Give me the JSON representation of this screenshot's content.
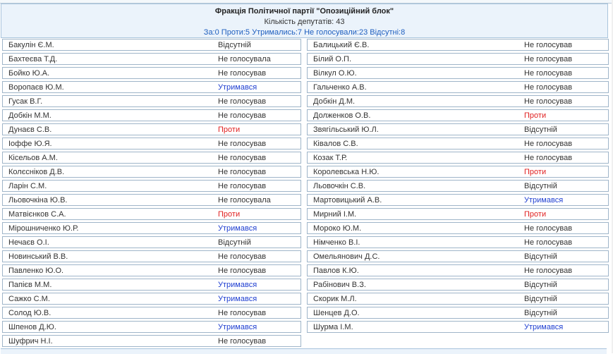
{
  "faction": {
    "title": "Фракція Політичної партії \"Опозиційний блок\"",
    "deputies_count": "Кількість депутатів: 43",
    "summary": "За:0 Проти:5 Утримались:7 Не голосували:23 Відсутні:8"
  },
  "colors": {
    "header_bg": "#ebf3fb",
    "border": "#9fb5c9",
    "summary_text": "#1f5fbf",
    "abstain": "#1f3fd1",
    "against": "#e02020"
  },
  "rows": [
    {
      "left": {
        "name": "Бакулін Є.М.",
        "vote": "Відсутній",
        "status": "absent"
      },
      "right": {
        "name": "Балицький Є.В.",
        "vote": "Не голосував",
        "status": "novote"
      }
    },
    {
      "left": {
        "name": "Бахтеєва Т.Д.",
        "vote": "Не голосувала",
        "status": "novote"
      },
      "right": {
        "name": "Білий О.П.",
        "vote": "Не голосував",
        "status": "novote"
      }
    },
    {
      "left": {
        "name": "Бойко Ю.А.",
        "vote": "Не голосував",
        "status": "novote"
      },
      "right": {
        "name": "Вілкул О.Ю.",
        "vote": "Не голосував",
        "status": "novote"
      }
    },
    {
      "left": {
        "name": "Воропаєв Ю.М.",
        "vote": "Утримався",
        "status": "abstain"
      },
      "right": {
        "name": "Гальченко А.В.",
        "vote": "Не голосував",
        "status": "novote"
      }
    },
    {
      "left": {
        "name": "Гусак В.Г.",
        "vote": "Не голосував",
        "status": "novote"
      },
      "right": {
        "name": "Добкін Д.М.",
        "vote": "Не голосував",
        "status": "novote"
      }
    },
    {
      "left": {
        "name": "Добкін М.М.",
        "vote": "Не голосував",
        "status": "novote"
      },
      "right": {
        "name": "Долженков О.В.",
        "vote": "Проти",
        "status": "against"
      }
    },
    {
      "left": {
        "name": "Дунаєв С.В.",
        "vote": "Проти",
        "status": "against"
      },
      "right": {
        "name": "Звягільський Ю.Л.",
        "vote": "Відсутній",
        "status": "absent"
      }
    },
    {
      "left": {
        "name": "Іоффе Ю.Я.",
        "vote": "Не голосував",
        "status": "novote"
      },
      "right": {
        "name": "Ківалов С.В.",
        "vote": "Не голосував",
        "status": "novote"
      }
    },
    {
      "left": {
        "name": "Кісельов А.М.",
        "vote": "Не голосував",
        "status": "novote"
      },
      "right": {
        "name": "Козак Т.Р.",
        "vote": "Не голосував",
        "status": "novote"
      }
    },
    {
      "left": {
        "name": "Колєсніков Д.В.",
        "vote": "Не голосував",
        "status": "novote"
      },
      "right": {
        "name": "Королевська Н.Ю.",
        "vote": "Проти",
        "status": "against"
      }
    },
    {
      "left": {
        "name": "Ларін С.М.",
        "vote": "Не голосував",
        "status": "novote"
      },
      "right": {
        "name": "Льовочкін С.В.",
        "vote": "Відсутній",
        "status": "absent"
      }
    },
    {
      "left": {
        "name": "Льовочкіна Ю.В.",
        "vote": "Не голосувала",
        "status": "novote"
      },
      "right": {
        "name": "Мартовицький А.В.",
        "vote": "Утримався",
        "status": "abstain"
      }
    },
    {
      "left": {
        "name": "Матвієнков С.А.",
        "vote": "Проти",
        "status": "against"
      },
      "right": {
        "name": "Мирний І.М.",
        "vote": "Проти",
        "status": "against"
      }
    },
    {
      "left": {
        "name": "Мірошниченко Ю.Р.",
        "vote": "Утримався",
        "status": "abstain"
      },
      "right": {
        "name": "Мороко Ю.М.",
        "vote": "Не голосував",
        "status": "novote"
      }
    },
    {
      "left": {
        "name": "Нечаєв О.І.",
        "vote": "Відсутній",
        "status": "absent"
      },
      "right": {
        "name": "Німченко В.І.",
        "vote": "Не голосував",
        "status": "novote"
      }
    },
    {
      "left": {
        "name": "Новинський В.В.",
        "vote": "Не голосував",
        "status": "novote"
      },
      "right": {
        "name": "Омельянович Д.С.",
        "vote": "Відсутній",
        "status": "absent"
      }
    },
    {
      "left": {
        "name": "Павленко Ю.О.",
        "vote": "Не голосував",
        "status": "novote"
      },
      "right": {
        "name": "Павлов К.Ю.",
        "vote": "Не голосував",
        "status": "novote"
      }
    },
    {
      "left": {
        "name": "Папієв М.М.",
        "vote": "Утримався",
        "status": "abstain"
      },
      "right": {
        "name": "Рабінович В.З.",
        "vote": "Відсутній",
        "status": "absent"
      }
    },
    {
      "left": {
        "name": "Сажко С.М.",
        "vote": "Утримався",
        "status": "abstain"
      },
      "right": {
        "name": "Скорик М.Л.",
        "vote": "Відсутній",
        "status": "absent"
      }
    },
    {
      "left": {
        "name": "Солод Ю.В.",
        "vote": "Не голосував",
        "status": "novote"
      },
      "right": {
        "name": "Шенцев Д.О.",
        "vote": "Відсутній",
        "status": "absent"
      }
    },
    {
      "left": {
        "name": "Шпенов Д.Ю.",
        "vote": "Утримався",
        "status": "abstain"
      },
      "right": {
        "name": "Шурма І.М.",
        "vote": "Утримався",
        "status": "abstain"
      }
    },
    {
      "left": {
        "name": "Шуфрич Н.І.",
        "vote": "Не голосував",
        "status": "novote"
      },
      "right": null
    }
  ]
}
